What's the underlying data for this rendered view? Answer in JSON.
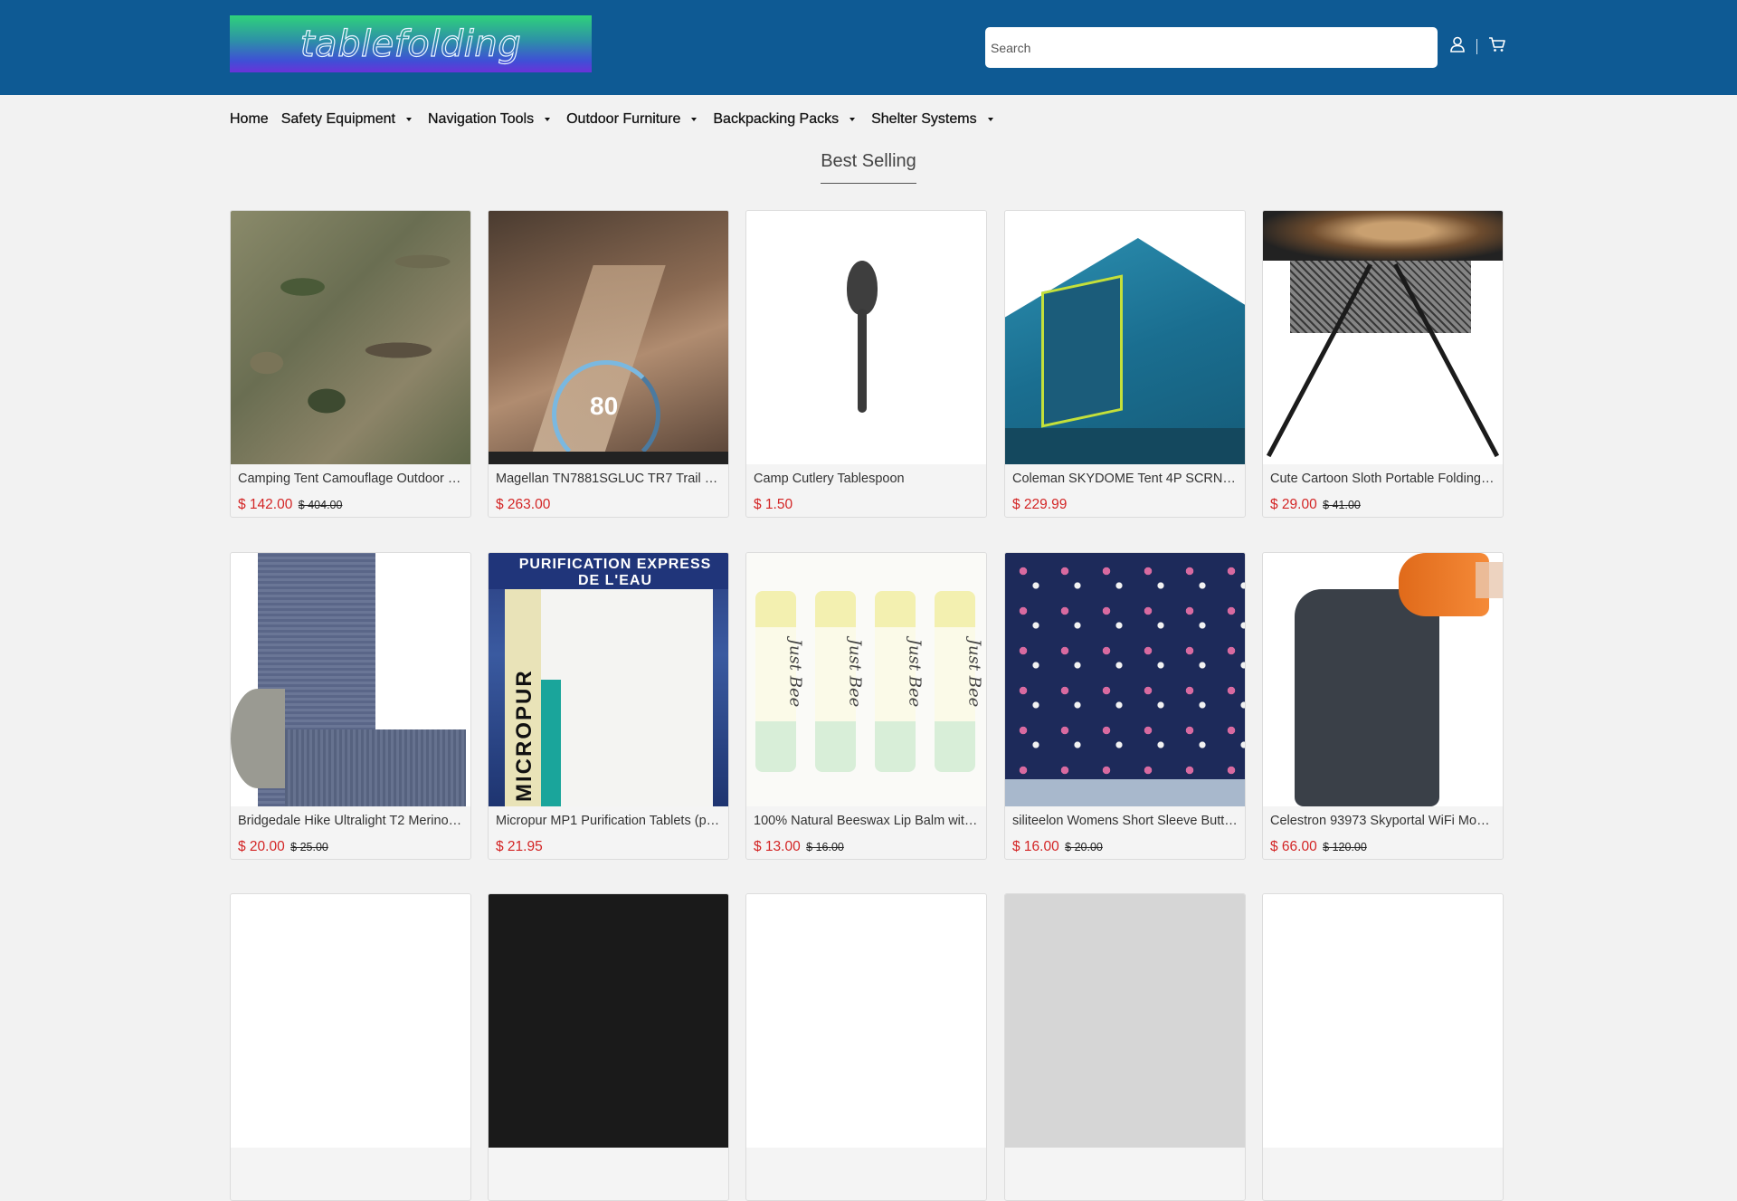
{
  "header": {
    "logo_text": "tablefolding",
    "search_placeholder": "Search",
    "icons": [
      "user-icon",
      "cart-icon"
    ]
  },
  "nav": {
    "items": [
      {
        "label": "Home",
        "dropdown": false
      },
      {
        "label": "Safety Equipment",
        "dropdown": true
      },
      {
        "label": "Navigation Tools",
        "dropdown": true
      },
      {
        "label": "Outdoor Furniture",
        "dropdown": true
      },
      {
        "label": "Backpacking Packs",
        "dropdown": true
      },
      {
        "label": "Shelter Systems",
        "dropdown": true
      }
    ]
  },
  "section": {
    "title": "Best Selling"
  },
  "products": [
    {
      "name": "Camping Tent Camouflage Outdoor S...",
      "price": "$ 142.00",
      "old_price": "$ 404.00"
    },
    {
      "name": "Magellan TN7881SGLUC TR7 Trail an...",
      "price": "$ 263.00",
      "old_price": ""
    },
    {
      "name": "Camp Cutlery Tablespoon",
      "price": "$ 1.50",
      "old_price": ""
    },
    {
      "name": "Coleman SKYDOME Tent 4P SCRN R...",
      "price": "$ 229.99",
      "old_price": ""
    },
    {
      "name": "Cute Cartoon Sloth Portable Folding C...",
      "price": "$ 29.00",
      "old_price": "$ 41.00"
    },
    {
      "name": "Bridgedale Hike Ultralight T2 Merino P...",
      "price": "$ 20.00",
      "old_price": "$ 25.00"
    },
    {
      "name": "Micropur MP1 Purification Tablets (pa...",
      "price": "$ 21.95",
      "old_price": ""
    },
    {
      "name": "100% Natural Beeswax Lip Balm with ...",
      "price": "$ 13.00",
      "old_price": "$ 16.00"
    },
    {
      "name": "siliteelon Womens Short Sleeve Butto...",
      "price": "$ 16.00",
      "old_price": "$ 20.00"
    },
    {
      "name": "Celestron 93973 Skyportal WiFi Modul...",
      "price": "$ 66.00",
      "old_price": "$ 120.00"
    }
  ],
  "image_text": {
    "gps_speed": "80",
    "micropur_header": "PURIFICATION EXPRESS DE L'EAU",
    "micropur_brand": "MICROPUR",
    "balm_label": "Just Bee"
  },
  "colors": {
    "header_bg": "#0e5a94",
    "page_bg": "#f2f2f2",
    "price_red": "#d32525"
  }
}
